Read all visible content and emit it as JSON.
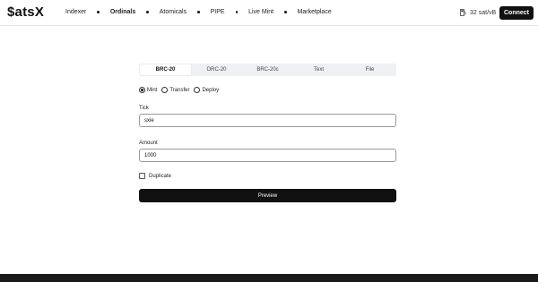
{
  "header": {
    "logo": "$atsX",
    "nav": [
      {
        "label": "Indexer",
        "active": false
      },
      {
        "label": "Ordinals",
        "active": true
      },
      {
        "label": "Atomicals",
        "active": false
      },
      {
        "label": "PIPE",
        "active": false
      },
      {
        "label": "Live Mint",
        "active": false
      },
      {
        "label": "Marketplace",
        "active": false
      }
    ],
    "fee_rate": "32 sat/vB",
    "connect_label": "Connect"
  },
  "tabs": [
    {
      "label": "BRC-20",
      "active": true
    },
    {
      "label": "ORC-20",
      "active": false
    },
    {
      "label": "BRC-20c",
      "active": false
    },
    {
      "label": "Text",
      "active": false
    },
    {
      "label": "File",
      "active": false
    }
  ],
  "operation": {
    "options": [
      "Mint",
      "Transfer",
      "Deploy"
    ],
    "selected": "Mint"
  },
  "form": {
    "tick_label": "Tick",
    "tick_value": "sxie",
    "amount_label": "Amount",
    "amount_value": "1000",
    "duplicate_label": "Duplicate",
    "duplicate_checked": false,
    "preview_label": "Preview"
  },
  "colors": {
    "primary": "#111111",
    "tab_bg": "#eef0f3",
    "footer": "#1a1a1a"
  }
}
